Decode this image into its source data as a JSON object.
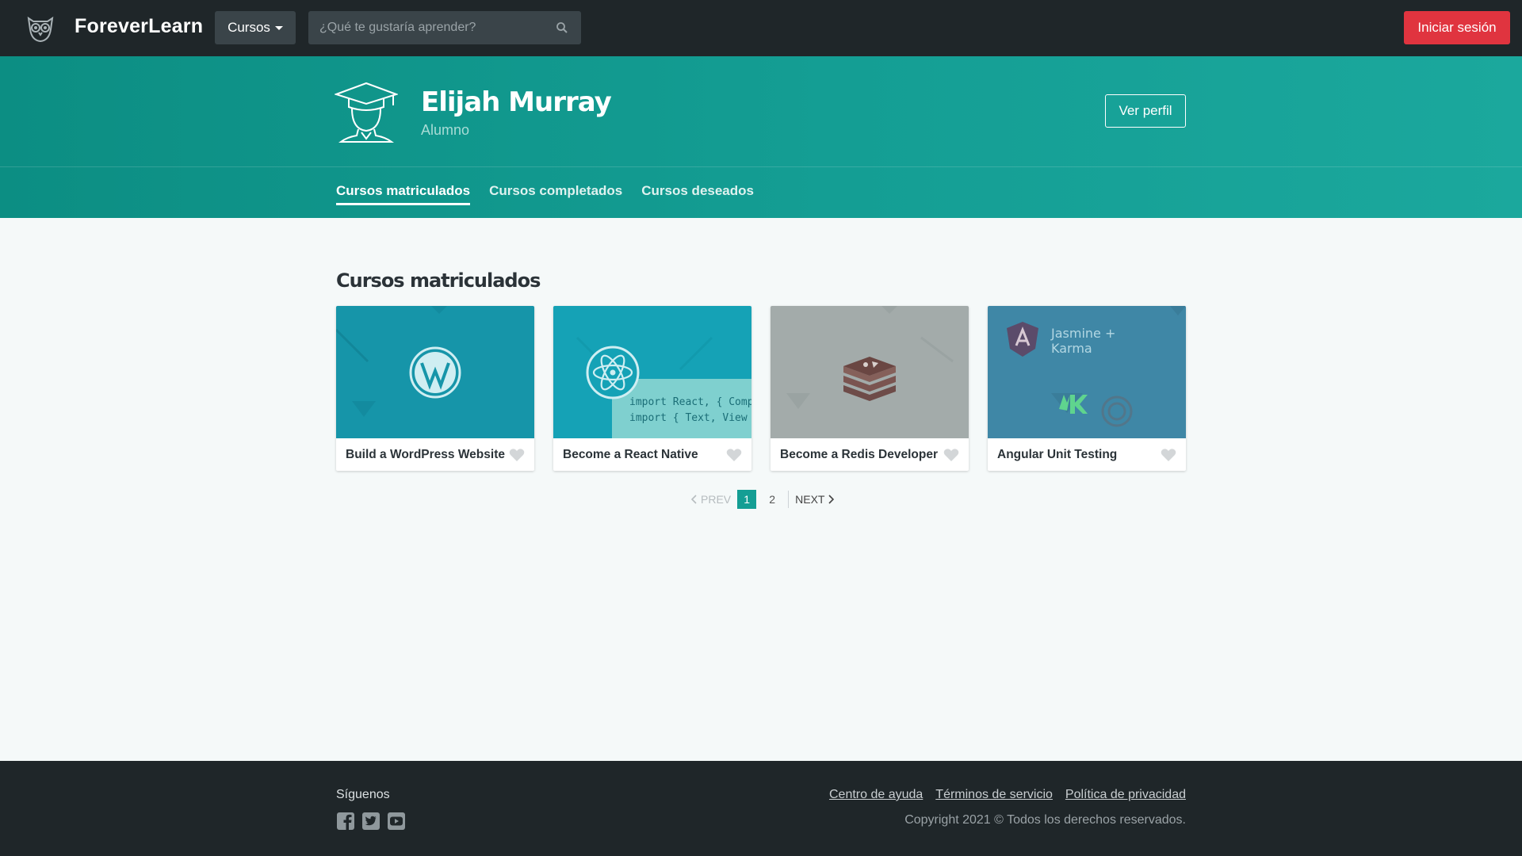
{
  "navbar": {
    "brand": "ForeverLearn",
    "courses_button": "Cursos",
    "search_placeholder": "¿Qué te gustaría aprender?",
    "login_button": "Iniciar sesión"
  },
  "profile": {
    "name": "Elijah Murray",
    "role": "Alumno",
    "view_profile_button": "Ver perfil"
  },
  "tabs": [
    {
      "label": "Cursos matriculados",
      "active": true
    },
    {
      "label": "Cursos completados",
      "active": false
    },
    {
      "label": "Cursos deseados",
      "active": false
    }
  ],
  "section_title": "Cursos matriculados",
  "courses": [
    {
      "title": "Build a WordPress Website",
      "thumb_color": "#1695a9",
      "icon": "wordpress-icon"
    },
    {
      "title": "Become a React Native",
      "thumb_color": "#15a2b6",
      "icon": "react-icon",
      "code_lines": [
        "import React, { Comp",
        "import { Text, View"
      ]
    },
    {
      "title": "Become a Redis Developer",
      "thumb_color": "#a3abaa",
      "icon": "redis-icon"
    },
    {
      "title": "Angular Unit Testing",
      "thumb_color": "#3f87a6",
      "icon": "angular-icon",
      "thumb_text": "Jasmine +\nKarma"
    }
  ],
  "pagination": {
    "prev": "PREV",
    "pages": [
      "1",
      "2"
    ],
    "current": "1",
    "next": "NEXT"
  },
  "footer": {
    "follow_label": "Síguenos",
    "social_icons": [
      "facebook-icon",
      "twitter-icon",
      "youtube-icon"
    ],
    "links": [
      "Centro de ayuda",
      "Términos de servicio",
      "Política de privacidad"
    ],
    "copyright": "Copyright 2021 © Todos los derechos reservados."
  },
  "colors": {
    "navbar": "#1f2629",
    "hero": "#149e94",
    "login": "#e0343f",
    "accent": "#149e94"
  }
}
